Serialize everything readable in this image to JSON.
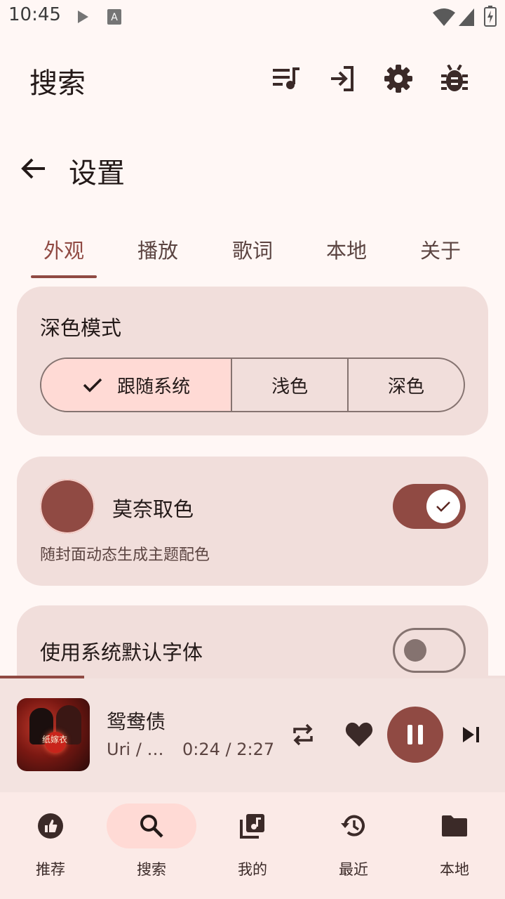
{
  "status_bar": {
    "time": "10:45"
  },
  "app_bar": {
    "title": "搜索",
    "icons": [
      "playlist-icon",
      "login-icon",
      "settings-icon",
      "bug-icon"
    ]
  },
  "settings": {
    "title": "设置",
    "tabs": [
      {
        "label": "外观",
        "active": true
      },
      {
        "label": "播放",
        "active": false
      },
      {
        "label": "歌词",
        "active": false
      },
      {
        "label": "本地",
        "active": false
      },
      {
        "label": "关于",
        "active": false
      }
    ],
    "dark_mode": {
      "title": "深色模式",
      "options": [
        "跟随系统",
        "浅色",
        "深色"
      ],
      "selected": "跟随系统"
    },
    "monet": {
      "title": "莫奈取色",
      "subtitle": "随封面动态生成主题配色",
      "enabled": true,
      "color": "#904a43"
    },
    "system_font": {
      "title": "使用系统默认字体",
      "enabled": false
    }
  },
  "player": {
    "song_title": "鸳鸯债",
    "artist": "Uri / …",
    "time": "0:24 / 2:27",
    "progress": 0.166,
    "album_text": "纸嫁衣"
  },
  "bottom_nav": [
    {
      "label": "推荐",
      "icon": "thumb-up-icon",
      "active": false
    },
    {
      "label": "搜索",
      "icon": "search-icon",
      "active": true
    },
    {
      "label": "我的",
      "icon": "library-music-icon",
      "active": false
    },
    {
      "label": "最近",
      "icon": "history-icon",
      "active": false
    },
    {
      "label": "本地",
      "icon": "folder-icon",
      "active": false
    }
  ],
  "colors": {
    "accent": "#904a43",
    "surface": "#fff7f5",
    "card": "#f1dedb",
    "selected": "#ffdad5"
  }
}
